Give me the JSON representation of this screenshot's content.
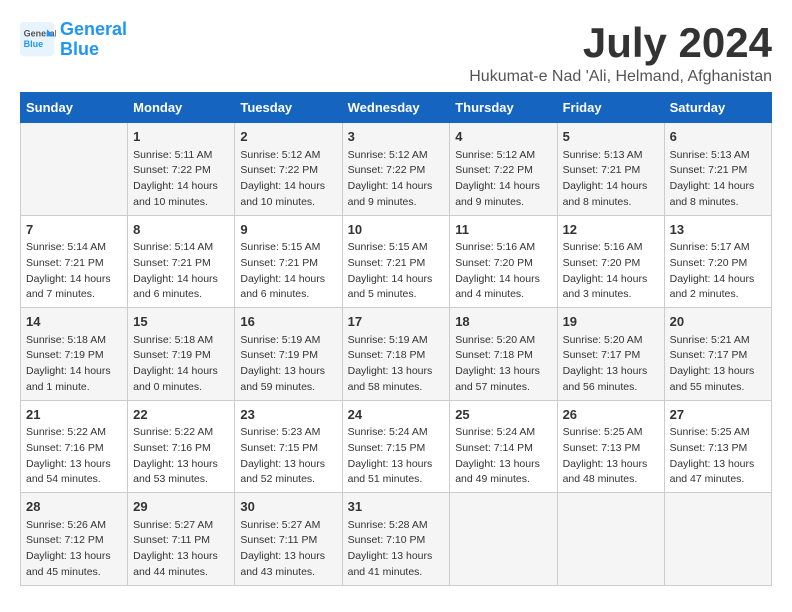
{
  "header": {
    "logo_line1": "General",
    "logo_line2": "Blue",
    "month_year": "July 2024",
    "location": "Hukumat-e Nad 'Ali, Helmand, Afghanistan"
  },
  "days_of_week": [
    "Sunday",
    "Monday",
    "Tuesday",
    "Wednesday",
    "Thursday",
    "Friday",
    "Saturday"
  ],
  "weeks": [
    [
      {
        "day": "",
        "content": ""
      },
      {
        "day": "1",
        "content": "Sunrise: 5:11 AM\nSunset: 7:22 PM\nDaylight: 14 hours\nand 10 minutes."
      },
      {
        "day": "2",
        "content": "Sunrise: 5:12 AM\nSunset: 7:22 PM\nDaylight: 14 hours\nand 10 minutes."
      },
      {
        "day": "3",
        "content": "Sunrise: 5:12 AM\nSunset: 7:22 PM\nDaylight: 14 hours\nand 9 minutes."
      },
      {
        "day": "4",
        "content": "Sunrise: 5:12 AM\nSunset: 7:22 PM\nDaylight: 14 hours\nand 9 minutes."
      },
      {
        "day": "5",
        "content": "Sunrise: 5:13 AM\nSunset: 7:21 PM\nDaylight: 14 hours\nand 8 minutes."
      },
      {
        "day": "6",
        "content": "Sunrise: 5:13 AM\nSunset: 7:21 PM\nDaylight: 14 hours\nand 8 minutes."
      }
    ],
    [
      {
        "day": "7",
        "content": "Sunrise: 5:14 AM\nSunset: 7:21 PM\nDaylight: 14 hours\nand 7 minutes."
      },
      {
        "day": "8",
        "content": "Sunrise: 5:14 AM\nSunset: 7:21 PM\nDaylight: 14 hours\nand 6 minutes."
      },
      {
        "day": "9",
        "content": "Sunrise: 5:15 AM\nSunset: 7:21 PM\nDaylight: 14 hours\nand 6 minutes."
      },
      {
        "day": "10",
        "content": "Sunrise: 5:15 AM\nSunset: 7:21 PM\nDaylight: 14 hours\nand 5 minutes."
      },
      {
        "day": "11",
        "content": "Sunrise: 5:16 AM\nSunset: 7:20 PM\nDaylight: 14 hours\nand 4 minutes."
      },
      {
        "day": "12",
        "content": "Sunrise: 5:16 AM\nSunset: 7:20 PM\nDaylight: 14 hours\nand 3 minutes."
      },
      {
        "day": "13",
        "content": "Sunrise: 5:17 AM\nSunset: 7:20 PM\nDaylight: 14 hours\nand 2 minutes."
      }
    ],
    [
      {
        "day": "14",
        "content": "Sunrise: 5:18 AM\nSunset: 7:19 PM\nDaylight: 14 hours\nand 1 minute."
      },
      {
        "day": "15",
        "content": "Sunrise: 5:18 AM\nSunset: 7:19 PM\nDaylight: 14 hours\nand 0 minutes."
      },
      {
        "day": "16",
        "content": "Sunrise: 5:19 AM\nSunset: 7:19 PM\nDaylight: 13 hours\nand 59 minutes."
      },
      {
        "day": "17",
        "content": "Sunrise: 5:19 AM\nSunset: 7:18 PM\nDaylight: 13 hours\nand 58 minutes."
      },
      {
        "day": "18",
        "content": "Sunrise: 5:20 AM\nSunset: 7:18 PM\nDaylight: 13 hours\nand 57 minutes."
      },
      {
        "day": "19",
        "content": "Sunrise: 5:20 AM\nSunset: 7:17 PM\nDaylight: 13 hours\nand 56 minutes."
      },
      {
        "day": "20",
        "content": "Sunrise: 5:21 AM\nSunset: 7:17 PM\nDaylight: 13 hours\nand 55 minutes."
      }
    ],
    [
      {
        "day": "21",
        "content": "Sunrise: 5:22 AM\nSunset: 7:16 PM\nDaylight: 13 hours\nand 54 minutes."
      },
      {
        "day": "22",
        "content": "Sunrise: 5:22 AM\nSunset: 7:16 PM\nDaylight: 13 hours\nand 53 minutes."
      },
      {
        "day": "23",
        "content": "Sunrise: 5:23 AM\nSunset: 7:15 PM\nDaylight: 13 hours\nand 52 minutes."
      },
      {
        "day": "24",
        "content": "Sunrise: 5:24 AM\nSunset: 7:15 PM\nDaylight: 13 hours\nand 51 minutes."
      },
      {
        "day": "25",
        "content": "Sunrise: 5:24 AM\nSunset: 7:14 PM\nDaylight: 13 hours\nand 49 minutes."
      },
      {
        "day": "26",
        "content": "Sunrise: 5:25 AM\nSunset: 7:13 PM\nDaylight: 13 hours\nand 48 minutes."
      },
      {
        "day": "27",
        "content": "Sunrise: 5:25 AM\nSunset: 7:13 PM\nDaylight: 13 hours\nand 47 minutes."
      }
    ],
    [
      {
        "day": "28",
        "content": "Sunrise: 5:26 AM\nSunset: 7:12 PM\nDaylight: 13 hours\nand 45 minutes."
      },
      {
        "day": "29",
        "content": "Sunrise: 5:27 AM\nSunset: 7:11 PM\nDaylight: 13 hours\nand 44 minutes."
      },
      {
        "day": "30",
        "content": "Sunrise: 5:27 AM\nSunset: 7:11 PM\nDaylight: 13 hours\nand 43 minutes."
      },
      {
        "day": "31",
        "content": "Sunrise: 5:28 AM\nSunset: 7:10 PM\nDaylight: 13 hours\nand 41 minutes."
      },
      {
        "day": "",
        "content": ""
      },
      {
        "day": "",
        "content": ""
      },
      {
        "day": "",
        "content": ""
      }
    ]
  ]
}
